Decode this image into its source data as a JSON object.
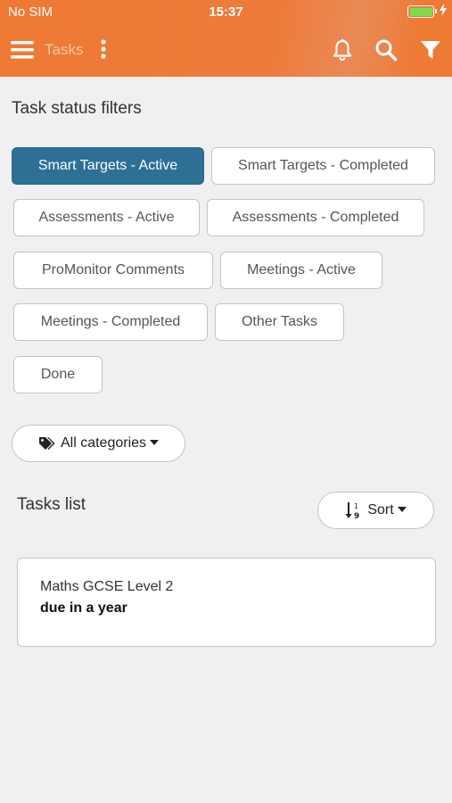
{
  "status_bar": {
    "carrier": "No SIM",
    "time": "15:37"
  },
  "nav": {
    "title": "Tasks",
    "menu_icon": "hamburger-icon",
    "more_icon": "kebab-icon",
    "bell_icon": "bell-icon",
    "search_icon": "search-icon",
    "filter_icon": "filter-icon"
  },
  "filters": {
    "heading": "Task status filters",
    "chips": [
      {
        "label": "Smart Targets - Active",
        "active": true
      },
      {
        "label": "Smart Targets - Completed",
        "active": false
      },
      {
        "label": "Assessments - Active",
        "active": false
      },
      {
        "label": "Assessments - Completed",
        "active": false
      },
      {
        "label": "ProMonitor Comments",
        "active": false
      },
      {
        "label": "Meetings - Active",
        "active": false
      },
      {
        "label": "Meetings - Completed",
        "active": false
      },
      {
        "label": "Other Tasks",
        "active": false
      },
      {
        "label": "Done",
        "active": false
      }
    ]
  },
  "categories": {
    "label": "All categories",
    "icon": "tags-icon"
  },
  "tasks_list": {
    "heading": "Tasks list",
    "sort_label": "Sort",
    "sort_icon": "sort-numeric-icon",
    "items": [
      {
        "title": "Maths GCSE Level 2",
        "due": "due in a year"
      }
    ]
  },
  "colors": {
    "header": "#ee7a35",
    "active_chip": "#2e7095",
    "background": "#f0f0f2"
  }
}
